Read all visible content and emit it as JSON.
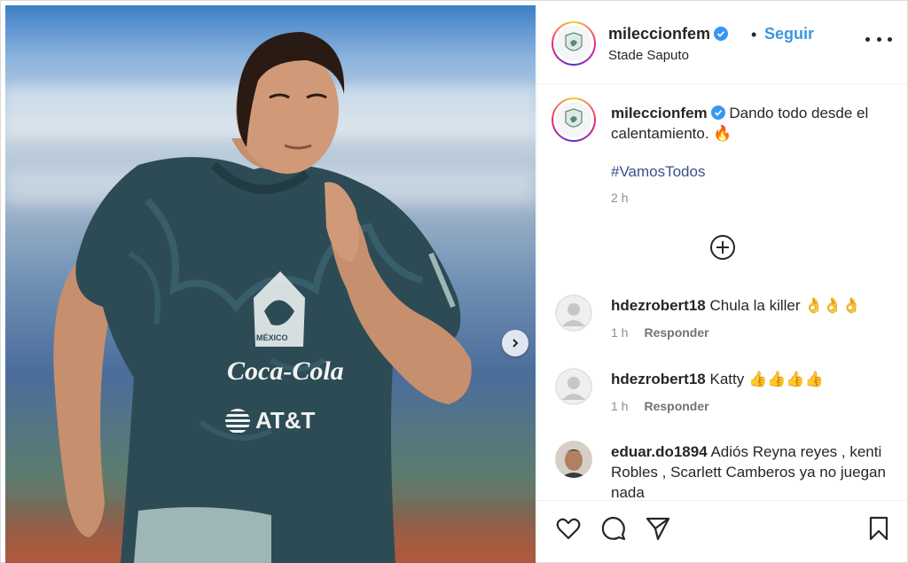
{
  "post": {
    "username": "mileccionfem",
    "location": "Stade Saputo",
    "follow_label": "Seguir",
    "separator": "•",
    "caption": "Dando todo desde el calentamiento. 🔥",
    "hashtag": "#VamosTodos",
    "time": "2 h",
    "photo": {
      "jersey_sponsor_1": "Coca-Cola",
      "jersey_sponsor_2": "AT&T",
      "crest_text": "MÉXICO"
    }
  },
  "comments": [
    {
      "username": "hdezrobert18",
      "text": "Chula la killer 👌👌👌",
      "time": "1 h",
      "reply_label": "Responder"
    },
    {
      "username": "hdezrobert18",
      "text": "Katty 👍👍👍👍",
      "time": "1 h",
      "reply_label": "Responder"
    },
    {
      "username": "eduar.do1894",
      "text": "Adiós Reyna reyes , kenti Robles , Scarlett Camberos ya no juegan nada"
    }
  ],
  "icons": {
    "verified": "verified-badge-icon",
    "more": "more-options-icon",
    "carousel_next": "chevron-right-icon",
    "load_more": "plus-circle-icon",
    "like": "heart-icon",
    "comment": "comment-icon",
    "share": "paper-plane-icon",
    "save": "bookmark-icon"
  },
  "colors": {
    "follow": "#3a96e0",
    "hashtag": "#38518b",
    "verified": "#3897f0",
    "jersey": "#2c4b55"
  }
}
